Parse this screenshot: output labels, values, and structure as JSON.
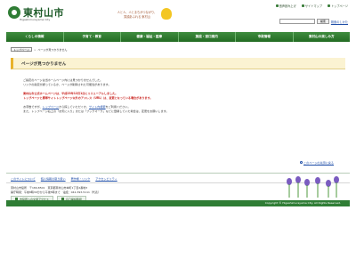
{
  "header": {
    "logo_text": "東村山市",
    "logo_sub": "Higashimurayama City",
    "tagline_lines": [
      "人と人、人とまちがつながり、",
      "笑顔あふれる 東村山"
    ],
    "utility": {
      "voice": "音声読み上げ",
      "sitemap": "サイトマップ",
      "top": "トップページ"
    },
    "search": {
      "placeholder": "",
      "button": "検索",
      "link": "検索のしかた"
    }
  },
  "nav": {
    "items": [
      "くらしの情報",
      "子育て・教育",
      "健康・福祉・医療",
      "施設・窓口案内",
      "市政情報",
      "東村山の楽しみ方"
    ]
  },
  "breadcrumb": {
    "home": "トップページ",
    "separator": ">",
    "current": "ページが見つかりません"
  },
  "page": {
    "title": "ページが見つかりません",
    "para1_line1": "ご指定のページは当ホームページ内には見つかりませんでした。",
    "para1_line2": "リンクの指定が誤っているか、ページが削除された可能性があります。",
    "red_line1": "東村山市公式ホームページは、平成23年12月1日にリニューアルしました。",
    "red_line2": "トップページと携帯サイトトップページ以外のアドレス（URL）は、変更となっている場合があります。",
    "p3_prefix": "お手数ですが、",
    "top_link": "トップページ",
    "p3_mid": "から探していただくか、",
    "sitemap_link": "サイト内検索",
    "p3_suffix": "をご利用ください。",
    "p3_line2": "また、トップページ右上の「お気に入り」または「ブックマーク」などに登録していた場合は、変更をお願いします。"
  },
  "back_link": "このページの先頭に戻る",
  "footer": {
    "links": [
      "このサイトについて",
      "個人情報の取り扱い",
      "著作権・リンク",
      "アクセシビリティ"
    ],
    "info_line1": "東村山市役所　〒189-8501　東京都東村山市本町1丁目2番地3",
    "info_line2": "開庁時間：午前8時30分から午後5時まで　電話：042-393-5111（代表）",
    "buttons": [
      "市役所への交通アクセス",
      "窓口開設時間"
    ],
    "copyright": "Copyright © Higashimurayama City. All Rights Reserved."
  },
  "colors": {
    "nav_green": "#2f7d35",
    "title_bg": "#fbf3d2",
    "title_accent": "#e8b22a",
    "alert_red": "#c8201c",
    "link_blue": "#1f4ea8"
  }
}
